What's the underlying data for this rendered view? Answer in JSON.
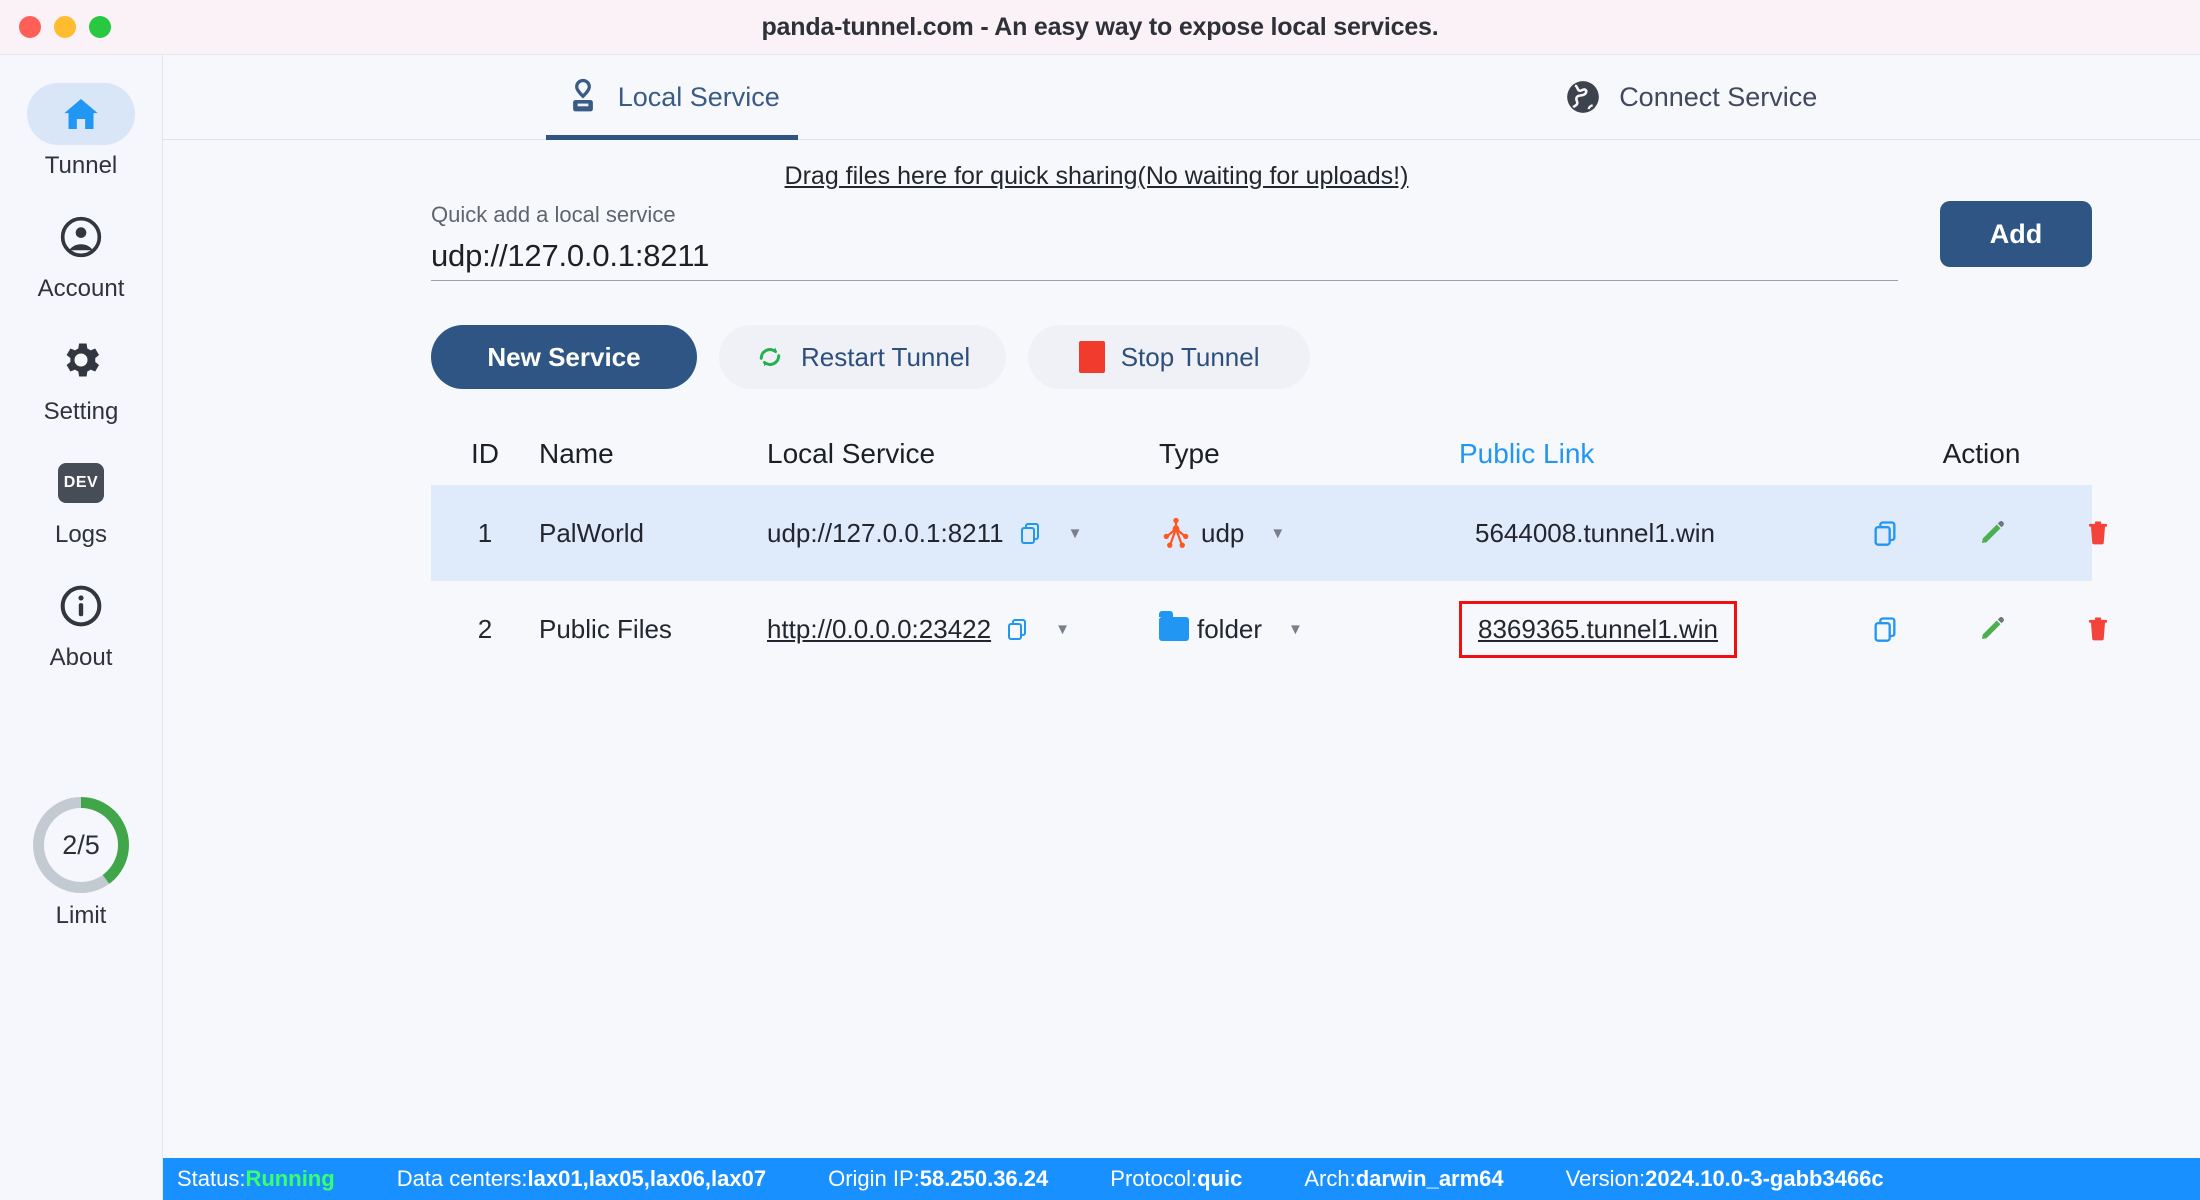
{
  "window": {
    "title": "panda-tunnel.com - An easy way to expose local services.",
    "traffic_lights": [
      "close",
      "minimize",
      "zoom"
    ]
  },
  "sidebar": {
    "items": [
      {
        "label": "Tunnel",
        "icon": "home-icon",
        "active": true
      },
      {
        "label": "Account",
        "icon": "account-icon",
        "active": false
      },
      {
        "label": "Setting",
        "icon": "gear-icon",
        "active": false
      },
      {
        "label": "Logs",
        "icon": "dev-badge-icon",
        "badge": "DEV",
        "active": false
      },
      {
        "label": "About",
        "icon": "info-icon",
        "active": false
      }
    ],
    "limit": {
      "value": "2/5",
      "label": "Limit",
      "used": 2,
      "total": 5,
      "percent": 40,
      "ring_color": "#41a64a",
      "track_color": "#c3cad2"
    }
  },
  "tabs": [
    {
      "label": "Local Service",
      "icon": "stamp-icon",
      "active": true
    },
    {
      "label": "Connect Service",
      "icon": "globe-icon",
      "active": false
    }
  ],
  "content": {
    "drag_hint": "Drag files here for quick sharing(No waiting for uploads!)",
    "quick_add": {
      "caption": "Quick add a local service",
      "value": "udp://127.0.0.1:8211",
      "placeholder": "udp://127.0.0.1:8211"
    },
    "add_button": "Add",
    "buttons": [
      {
        "label": "New Service",
        "style": "primary",
        "icon": "none"
      },
      {
        "label": "Restart Tunnel",
        "style": "ghost",
        "icon": "refresh-icon"
      },
      {
        "label": "Stop Tunnel",
        "style": "ghost",
        "icon": "stop-icon"
      }
    ]
  },
  "table": {
    "columns": [
      "ID",
      "Name",
      "Local Service",
      "Type",
      "Public Link",
      "Action"
    ],
    "rows": [
      {
        "id": "1",
        "name": "PalWorld",
        "local_service": "udp://127.0.0.1:8211",
        "local_underline": false,
        "type": "udp",
        "type_icon": "udp-node-icon",
        "public_link": "5644008.tunnel1.win",
        "link_highlighted": false,
        "link_underline": false,
        "highlighted_row": true
      },
      {
        "id": "2",
        "name": "Public Files",
        "local_service": "http://0.0.0.0:23422",
        "local_underline": true,
        "type": "folder",
        "type_icon": "folder-icon",
        "public_link": "8369365.tunnel1.win",
        "link_highlighted": true,
        "link_underline": true,
        "highlighted_row": false
      }
    ],
    "row_actions": [
      "copy-icon",
      "edit-icon",
      "delete-icon"
    ]
  },
  "statusbar": {
    "status_label": "Status:",
    "status_value": "Running",
    "data_centers_label": "Data centers:",
    "data_centers_value": "lax01,lax05,lax06,lax07",
    "origin_ip_label": "Origin IP:",
    "origin_ip_value": "58.250.36.24",
    "protocol_label": "Protocol:",
    "protocol_value": "quic",
    "arch_label": "Arch:",
    "arch_value": "darwin_arm64",
    "version_label": "Version:",
    "version_value": "2024.10.0-3-gabb3466c"
  },
  "colors": {
    "accent": "#2e5583",
    "link": "#2196f3",
    "status_bar": "#1890ff",
    "running_green": "#39ff6f",
    "highlight_red": "#f01010",
    "row_highlight": "#dfeafb"
  }
}
